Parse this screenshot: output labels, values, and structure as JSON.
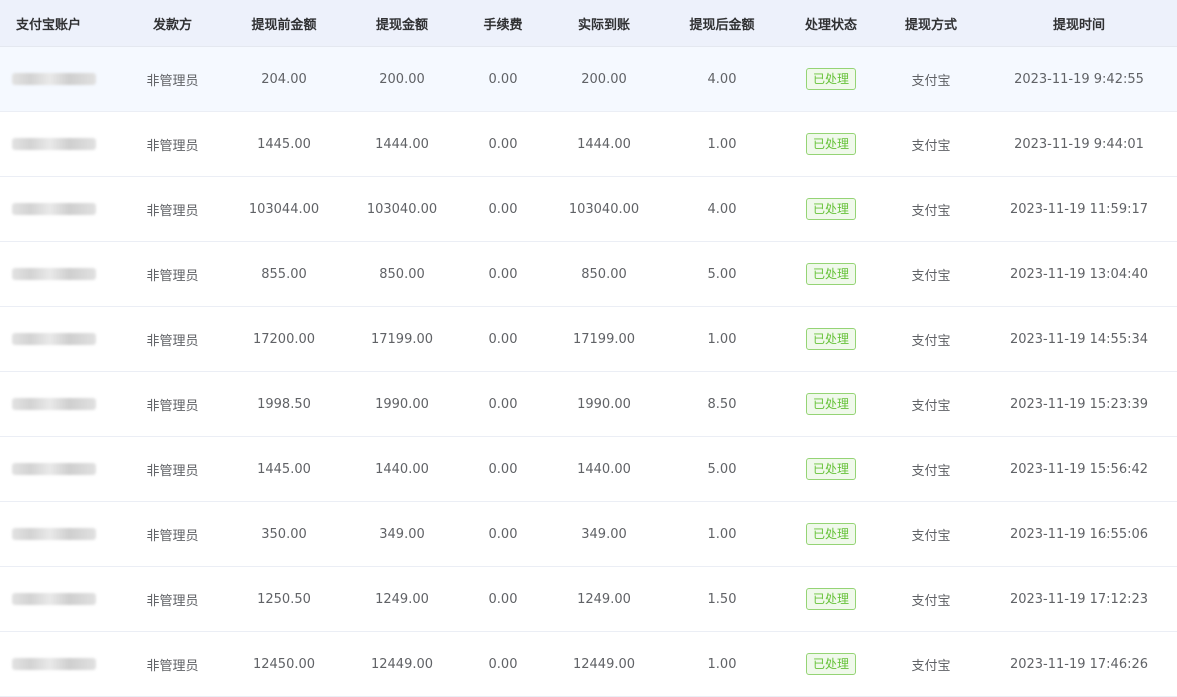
{
  "table": {
    "columns": [
      "支付宝账户",
      "发款方",
      "提现前金额",
      "提现金额",
      "手续费",
      "实际到账",
      "提现后金额",
      "处理状态",
      "提现方式",
      "提现时间"
    ],
    "rows": [
      {
        "payer": "非管理员",
        "before": "204.00",
        "amount": "200.00",
        "fee": "0.00",
        "received": "200.00",
        "after": "4.00",
        "status": "已处理",
        "method": "支付宝",
        "time": "2023-11-19 9:42:55"
      },
      {
        "payer": "非管理员",
        "before": "1445.00",
        "amount": "1444.00",
        "fee": "0.00",
        "received": "1444.00",
        "after": "1.00",
        "status": "已处理",
        "method": "支付宝",
        "time": "2023-11-19 9:44:01"
      },
      {
        "payer": "非管理员",
        "before": "103044.00",
        "amount": "103040.00",
        "fee": "0.00",
        "received": "103040.00",
        "after": "4.00",
        "status": "已处理",
        "method": "支付宝",
        "time": "2023-11-19 11:59:17"
      },
      {
        "payer": "非管理员",
        "before": "855.00",
        "amount": "850.00",
        "fee": "0.00",
        "received": "850.00",
        "after": "5.00",
        "status": "已处理",
        "method": "支付宝",
        "time": "2023-11-19 13:04:40"
      },
      {
        "payer": "非管理员",
        "before": "17200.00",
        "amount": "17199.00",
        "fee": "0.00",
        "received": "17199.00",
        "after": "1.00",
        "status": "已处理",
        "method": "支付宝",
        "time": "2023-11-19 14:55:34"
      },
      {
        "payer": "非管理员",
        "before": "1998.50",
        "amount": "1990.00",
        "fee": "0.00",
        "received": "1990.00",
        "after": "8.50",
        "status": "已处理",
        "method": "支付宝",
        "time": "2023-11-19 15:23:39"
      },
      {
        "payer": "非管理员",
        "before": "1445.00",
        "amount": "1440.00",
        "fee": "0.00",
        "received": "1440.00",
        "after": "5.00",
        "status": "已处理",
        "method": "支付宝",
        "time": "2023-11-19 15:56:42"
      },
      {
        "payer": "非管理员",
        "before": "350.00",
        "amount": "349.00",
        "fee": "0.00",
        "received": "349.00",
        "after": "1.00",
        "status": "已处理",
        "method": "支付宝",
        "time": "2023-11-19 16:55:06"
      },
      {
        "payer": "非管理员",
        "before": "1250.50",
        "amount": "1249.00",
        "fee": "0.00",
        "received": "1249.00",
        "after": "1.50",
        "status": "已处理",
        "method": "支付宝",
        "time": "2023-11-19 17:12:23"
      },
      {
        "payer": "非管理员",
        "before": "12450.00",
        "amount": "12449.00",
        "fee": "0.00",
        "received": "12449.00",
        "after": "1.00",
        "status": "已处理",
        "method": "支付宝",
        "time": "2023-11-19 17:46:26"
      }
    ]
  },
  "colors": {
    "header_bg": "#edf1fb",
    "status_green": "#67c23a",
    "row_highlight": "#f5f9ff"
  }
}
